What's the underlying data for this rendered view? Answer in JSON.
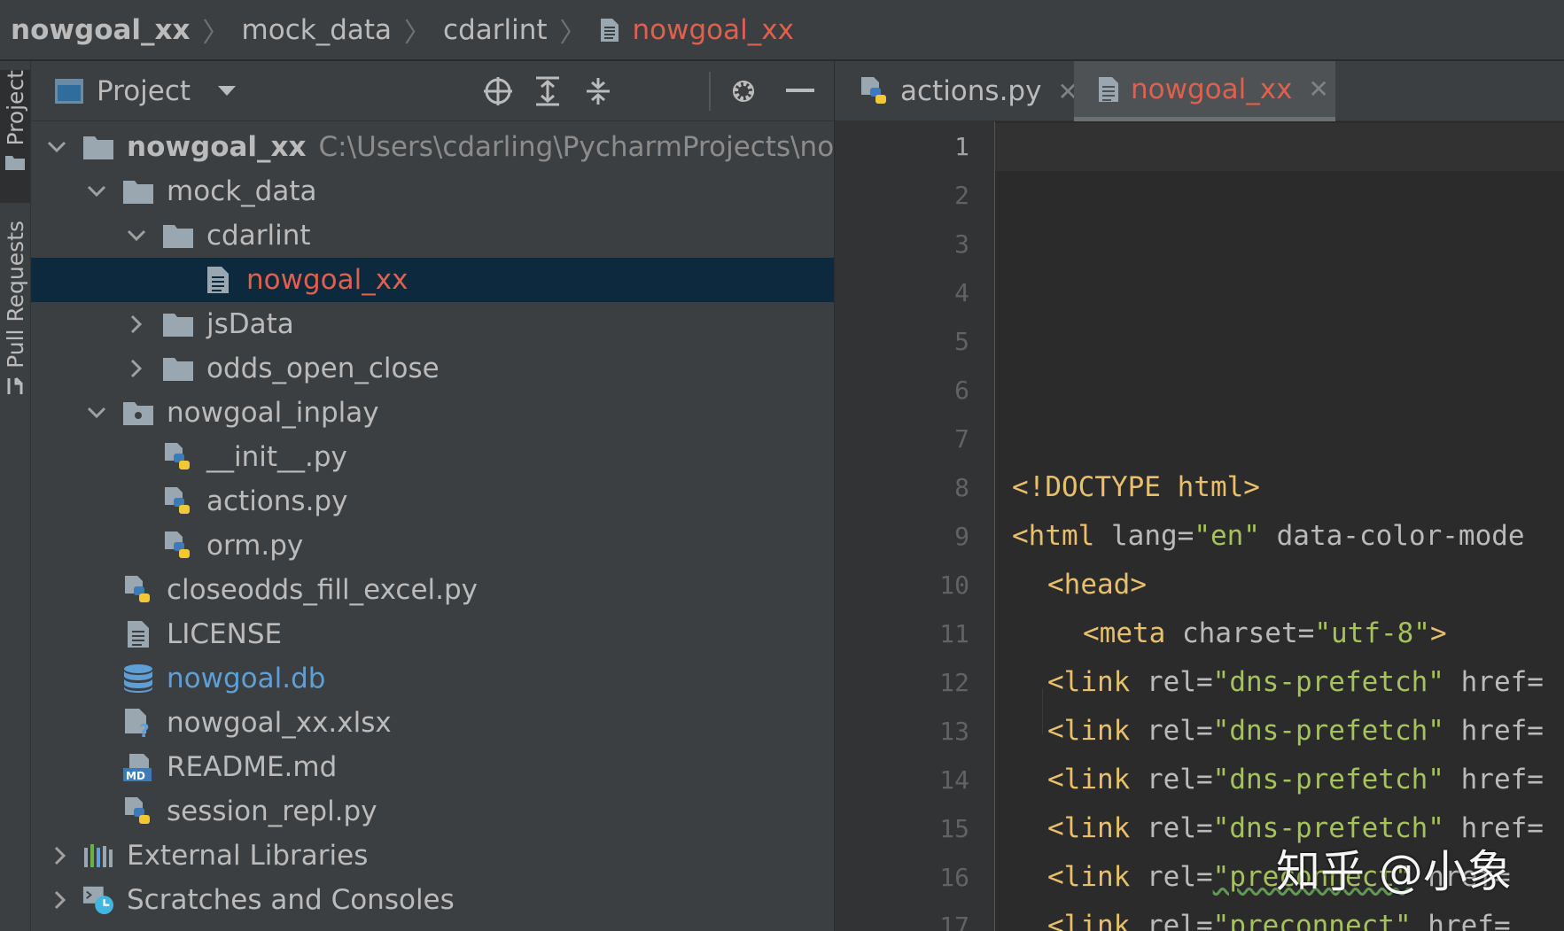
{
  "breadcrumb": {
    "items": [
      "nowgoal_xx",
      "mock_data",
      "cdarlint",
      "nowgoal_xx"
    ],
    "separator": "〉"
  },
  "tool_strip": {
    "project_label": "Project",
    "pull_requests_label": "Pull Requests"
  },
  "project_panel": {
    "title": "Project",
    "root": {
      "name": "nowgoal_xx",
      "path": "C:\\Users\\cdarling\\PycharmProjects\\nowgo"
    },
    "tree": [
      {
        "label": "mock_data"
      },
      {
        "label": "cdarlint"
      },
      {
        "label": "nowgoal_xx"
      },
      {
        "label": "jsData"
      },
      {
        "label": "odds_open_close"
      },
      {
        "label": "nowgoal_inplay"
      },
      {
        "label": "__init__.py"
      },
      {
        "label": "actions.py"
      },
      {
        "label": "orm.py"
      },
      {
        "label": "closeodds_fill_excel.py"
      },
      {
        "label": "LICENSE"
      },
      {
        "label": "nowgoal.db"
      },
      {
        "label": "nowgoal_xx.xlsx"
      },
      {
        "label": "README.md"
      },
      {
        "label": "session_repl.py"
      },
      {
        "label": "External Libraries"
      },
      {
        "label": "Scratches and Consoles"
      }
    ]
  },
  "editor": {
    "tabs": [
      {
        "label": "actions.py",
        "close": "✕"
      },
      {
        "label": "nowgoal_xx",
        "close": "✕"
      }
    ],
    "line_numbers": [
      "1",
      "2",
      "3",
      "4",
      "5",
      "6",
      "7",
      "8",
      "9",
      "10",
      "11",
      "12",
      "13",
      "14",
      "15",
      "16",
      "17"
    ],
    "code": {
      "l8": "<!DOCTYPE html>",
      "l9_tag": "<html",
      "l9_attr1": " lang=",
      "l9_str1": "\"en\"",
      "l9_attr2": " data-color-mode",
      "l10": "<head>",
      "l11_tag": "<meta",
      "l11_attr": " charset=",
      "l11_str": "\"utf-8\"",
      "l11_end": ">",
      "link_tag": "<link",
      "link_attr": " rel=",
      "prefetch_str": "\"dns-prefetch\"",
      "href_attr": " href=",
      "preconnect_str": "\"preconnect\""
    }
  },
  "watermark": "知乎 @小象",
  "colors": {
    "selected_row": "#0d293e",
    "active_file": "#e0604e",
    "db_file": "#5d9fd6"
  }
}
